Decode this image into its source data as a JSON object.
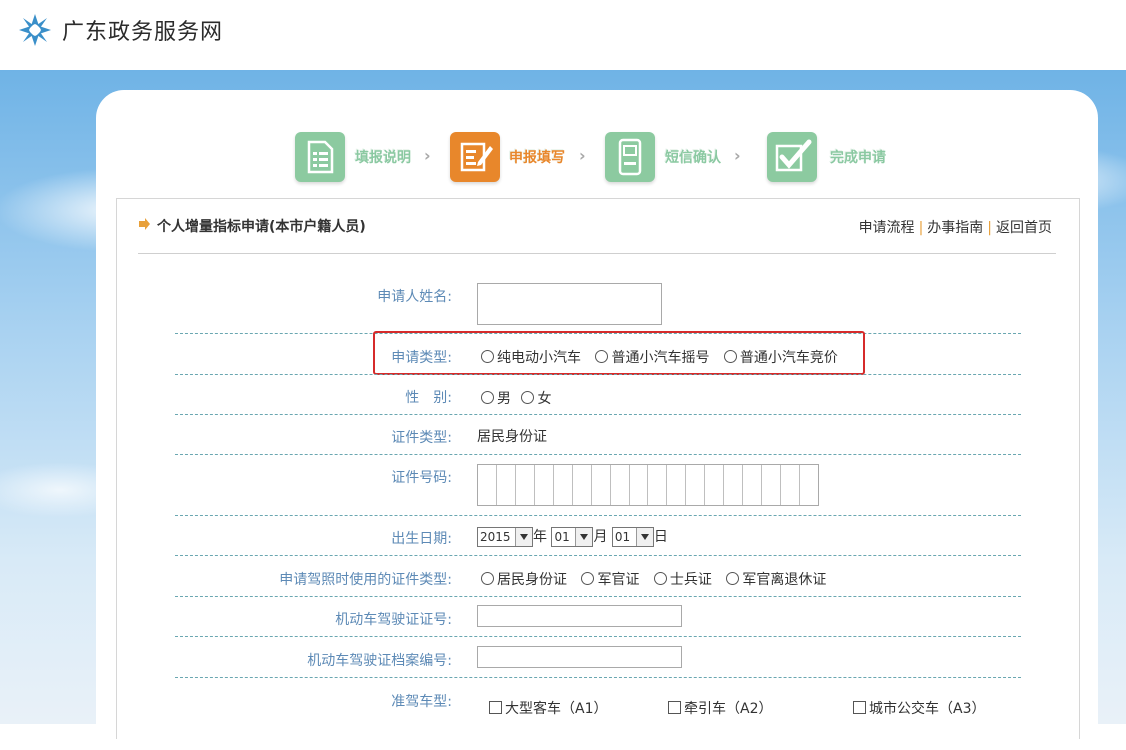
{
  "header": {
    "site_title": "广东政务服务网"
  },
  "steps": [
    {
      "label": "填报说明",
      "active": false
    },
    {
      "label": "申报填写",
      "active": true
    },
    {
      "label": "短信确认",
      "active": false
    },
    {
      "label": "完成申请",
      "active": false
    }
  ],
  "panel": {
    "title": "个人增量指标申请(本市户籍人员)",
    "links": [
      "申请流程",
      "办事指南",
      "返回首页"
    ]
  },
  "form": {
    "name_label": "申请人姓名:",
    "type_label": "申请类型:",
    "type_options": [
      "纯电动小汽车",
      "普通小汽车摇号",
      "普通小汽车竞价"
    ],
    "gender_label": "性　别:",
    "gender_options": [
      "男",
      "女"
    ],
    "id_type_label": "证件类型:",
    "id_type_value": "居民身份证",
    "id_number_label": "证件号码:",
    "birth_label": "出生日期:",
    "birth_year": "2015",
    "birth_month": "01",
    "birth_day": "01",
    "year_unit": "年",
    "month_unit": "月",
    "day_unit": "日",
    "license_id_type_label": "申请驾照时使用的证件类型:",
    "license_id_type_options": [
      "居民身份证",
      "军官证",
      "士兵证",
      "军官离退休证"
    ],
    "license_no_label": "机动车驾驶证证号:",
    "license_file_label": "机动车驾驶证档案编号:",
    "vehicle_class_label": "准驾车型:",
    "vehicle_class_options": [
      "大型客车（A1）",
      "牵引车（A2）",
      "城市公交车（A3）"
    ]
  },
  "colors": {
    "label_blue": "#5d8ab6",
    "step_green": "#8ccaa0",
    "step_orange": "#e8872b",
    "highlight_red": "#d62b2b",
    "link_separator": "#e8a03a"
  }
}
